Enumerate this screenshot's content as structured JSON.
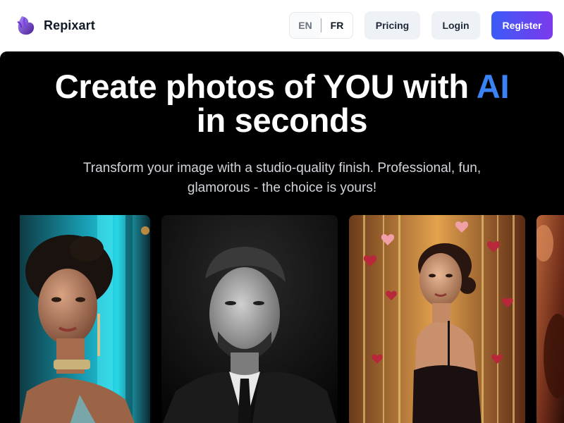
{
  "brand": {
    "name": "Repixart",
    "logo_icon": "purple-leaf-logo-icon"
  },
  "language": {
    "options": [
      "EN",
      "FR"
    ],
    "selected": "FR"
  },
  "nav": {
    "pricing_label": "Pricing",
    "login_label": "Login",
    "register_label": "Register"
  },
  "hero": {
    "title_line1_main": "Create photos of YOU with",
    "title_line1_accent": "AI",
    "title_line2": "in seconds",
    "subtitle_line1": "Transform your image with a studio-quality finish. Professional, fun,",
    "subtitle_line2": "glamorous - the choice is yours!"
  },
  "colors": {
    "accent": "#3b82f6",
    "register_gradient": [
      "#3b5bf6",
      "#7c3aed"
    ],
    "hero_background": "#000000"
  },
  "gallery": {
    "photos": [
      {
        "name": "woman-teal-neon-portrait"
      },
      {
        "name": "man-black-and-white-portrait"
      },
      {
        "name": "woman-valentine-bokeh-portrait"
      },
      {
        "name": "warm-portrait-partial"
      }
    ]
  }
}
